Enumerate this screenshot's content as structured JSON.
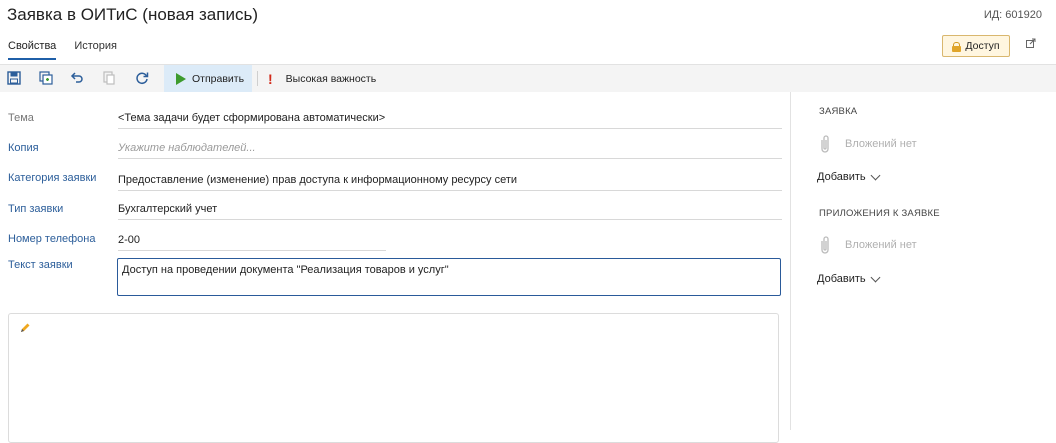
{
  "header": {
    "title": "Заявка в ОИТиС (новая запись)",
    "record_id": "ИД: 601920",
    "tabs": [
      {
        "label": "Свойства",
        "active": true
      },
      {
        "label": "История",
        "active": false
      }
    ],
    "access_button": "Доступ"
  },
  "toolbar": {
    "send_label": "Отправить",
    "importance_label": "Высокая важность",
    "icons": [
      "save-icon",
      "save-copy-icon",
      "undo-icon",
      "copy-icon",
      "refresh-icon"
    ]
  },
  "form": {
    "topic": {
      "label": "Тема",
      "value": "<Тема задачи будет сформирована автоматически>"
    },
    "copy": {
      "label": "Копия",
      "placeholder": "Укажите наблюдателей..."
    },
    "category": {
      "label": "Категория заявки",
      "value": "Предоставление (изменение) прав доступа к информационному ресурсу сети"
    },
    "type": {
      "label": "Тип заявки",
      "value": "Бухгалтерский учет"
    },
    "phone": {
      "label": "Номер телефона",
      "value": "2-00"
    },
    "text": {
      "label": "Текст заявки",
      "value": "Доступ на проведении  документа \"Реализация товаров и услуг\""
    }
  },
  "attachments": {
    "request": {
      "title": "ЗАЯВКА",
      "empty_label": "Вложений нет",
      "add_label": "Добавить"
    },
    "appendix": {
      "title": "ПРИЛОЖЕНИЯ К ЗАЯВКЕ",
      "empty_label": "Вложений нет",
      "add_label": "Добавить"
    }
  },
  "colors": {
    "accent": "#2c5e9a",
    "send_bg": "#dcebf8",
    "play": "#3d9b2e",
    "importance": "#d12a1a",
    "access_bg": "#fff6e0"
  }
}
